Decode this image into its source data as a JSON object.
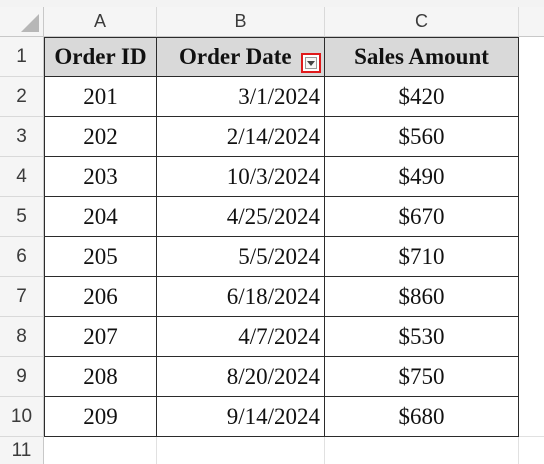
{
  "columns": [
    "A",
    "B",
    "C"
  ],
  "rows": [
    "1",
    "2",
    "3",
    "4",
    "5",
    "6",
    "7",
    "8",
    "9",
    "10",
    "11"
  ],
  "table": {
    "headers": [
      "Order ID",
      "Order Date",
      "Sales Amount"
    ],
    "data": [
      [
        "201",
        "3/1/2024",
        "$420"
      ],
      [
        "202",
        "2/14/2024",
        "$560"
      ],
      [
        "203",
        "10/3/2024",
        "$490"
      ],
      [
        "204",
        "4/25/2024",
        "$670"
      ],
      [
        "205",
        "5/5/2024",
        "$710"
      ],
      [
        "206",
        "6/18/2024",
        "$860"
      ],
      [
        "207",
        "4/7/2024",
        "$530"
      ],
      [
        "208",
        "8/20/2024",
        "$750"
      ],
      [
        "209",
        "9/14/2024",
        "$680"
      ]
    ]
  },
  "icons": {
    "filter": "filter-dropdown-icon"
  },
  "colors": {
    "highlight_border": "#e0191b",
    "header_fill": "#d9d9d9"
  }
}
